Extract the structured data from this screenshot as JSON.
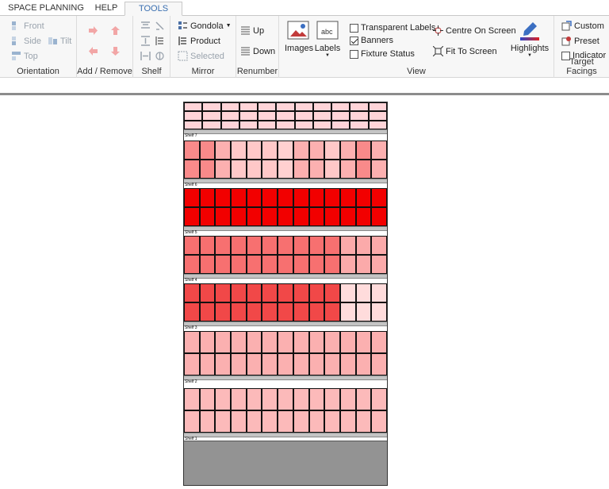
{
  "tabs": [
    {
      "label": "SPACE PLANNING",
      "active": false
    },
    {
      "label": "HELP",
      "active": false
    },
    {
      "label": "TOOLS",
      "active": true
    }
  ],
  "ribbon": {
    "orientation": {
      "label": "Orientation",
      "front": "Front",
      "side": "Side",
      "top": "Top",
      "tilt": "Tilt"
    },
    "add_remove": {
      "label": "Add / Remove"
    },
    "shelf": {
      "label": "Shelf"
    },
    "mirror": {
      "label": "Mirror",
      "gondola": "Gondola",
      "product": "Product",
      "selected": "Selected"
    },
    "renumber": {
      "label": "Renumber",
      "up": "Up",
      "down": "Down"
    },
    "view": {
      "label": "View",
      "images": "Images",
      "labels": "Labels",
      "transparent_labels": {
        "label": "Transparent Labels",
        "checked": false
      },
      "banners": {
        "label": "Banners",
        "checked": true
      },
      "fixture_status": {
        "label": "Fixture Status",
        "checked": false
      },
      "centre_on_screen": "Centre On Screen",
      "fit_to_screen": "Fit To Screen",
      "highlights": "Highlights"
    },
    "target_facings": {
      "label": "Target Facings",
      "custom": "Custom",
      "preset": "Preset",
      "indicator": {
        "label": "Indicator",
        "checked": false
      }
    }
  },
  "planogram": {
    "shelves": [
      {
        "label": "Shelf 7",
        "rows": 3,
        "colors": [
          "#ffd4d8",
          "#ffd4d8",
          "#ffd4d8",
          "#ffd4d8",
          "#ffd4d8",
          "#ffd4d8",
          "#ffd4d8",
          "#ffd4d8",
          "#ffd4d8",
          "#ffd4d8",
          "#ffd4d8"
        ]
      },
      {
        "label": "Shelf 6",
        "rows": 2,
        "colors": [
          "#f98a8a",
          "#f98a8a",
          "#fcb0b0",
          "#ffc8c8",
          "#ffc8c8",
          "#ffc8c8",
          "#ffd0d0",
          "#fcb0b0",
          "#fcb0b0",
          "#ffc8c8",
          "#fcb0b0",
          "#f98a8a",
          "#fcb0b0"
        ]
      },
      {
        "label": "Shelf 5",
        "rows": 2,
        "colors": [
          "#f20000",
          "#f20000",
          "#f20000",
          "#f20000",
          "#f20000",
          "#f20000",
          "#f20000",
          "#f20000",
          "#f20000",
          "#f20000",
          "#f20000",
          "#f20000",
          "#f20000"
        ]
      },
      {
        "label": "Shelf 4",
        "rows": 2,
        "colors": [
          "#f77070",
          "#f77070",
          "#f77070",
          "#f77070",
          "#f77070",
          "#f77070",
          "#f77070",
          "#f77070",
          "#f77070",
          "#f77070",
          "#fbaaaa",
          "#fbaaaa",
          "#fbaaaa"
        ]
      },
      {
        "label": "Shelf 3",
        "rows": 2,
        "colors": [
          "#f14848",
          "#f14848",
          "#f14848",
          "#f14848",
          "#f14848",
          "#f14848",
          "#f14848",
          "#f14848",
          "#f14848",
          "#f14848",
          "#ffdcdc",
          "#ffdcdc",
          "#ffdcdc"
        ]
      },
      {
        "label": "Shelf 2",
        "rows": 2,
        "colors": [
          "#fbb0b0",
          "#fbb0b0",
          "#fbb0b0",
          "#fbb0b0",
          "#fbb0b0",
          "#fbb0b0",
          "#fbb0b0",
          "#fbb0b0",
          "#fbb0b0",
          "#fbb0b0",
          "#fbb0b0",
          "#fbb0b0",
          "#fbb0b0"
        ]
      },
      {
        "label": "Shelf 1",
        "rows": 2,
        "colors": [
          "#fcbaba",
          "#fcbaba",
          "#fcbaba",
          "#fcbaba",
          "#fcbaba",
          "#fcbaba",
          "#fcbaba",
          "#fcbaba",
          "#fcbaba",
          "#fcbaba",
          "#fcbaba",
          "#fcbaba",
          "#fcbaba"
        ]
      }
    ]
  }
}
